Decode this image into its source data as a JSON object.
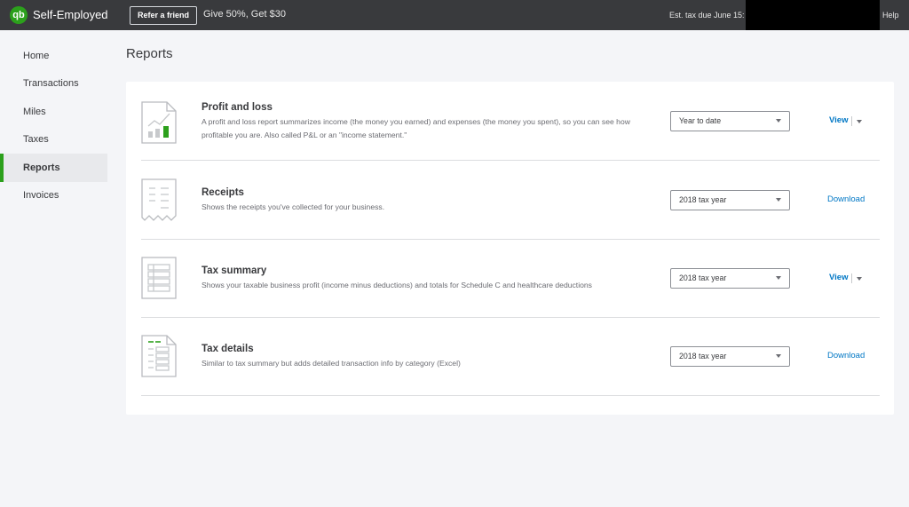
{
  "topbar": {
    "logo_text": "qb",
    "brand": "Self-Employed",
    "refer_button": "Refer a friend",
    "promo": "Give 50%, Get $30",
    "tax_due_label": "Est. tax due June 15:",
    "help": "Help"
  },
  "sidebar": {
    "items": [
      {
        "label": "Home"
      },
      {
        "label": "Transactions"
      },
      {
        "label": "Miles"
      },
      {
        "label": "Taxes"
      },
      {
        "label": "Reports",
        "active": true
      },
      {
        "label": "Invoices"
      }
    ]
  },
  "page": {
    "title": "Reports"
  },
  "reports": [
    {
      "title": "Profit and loss",
      "description": "A profit and loss report summarizes income (the money you earned) and expenses (the money you spent), so you can see how profitable you are. Also called P&L or an \"income statement.\"",
      "selected_period": "Year to date",
      "action": "View",
      "icon": "profit-loss-chart-icon"
    },
    {
      "title": "Receipts",
      "description": "Shows the receipts you've collected for your business.",
      "selected_period": "2018 tax year",
      "action": "Download",
      "icon": "receipt-icon"
    },
    {
      "title": "Tax summary",
      "description": "Shows your taxable business profit (income minus deductions) and totals for Schedule C and healthcare deductions",
      "selected_period": "2018 tax year",
      "action": "View",
      "icon": "tax-summary-icon"
    },
    {
      "title": "Tax details",
      "description": "Similar to tax summary but adds detailed transaction info by category (Excel)",
      "selected_period": "2018 tax year",
      "action": "Download",
      "icon": "tax-details-icon"
    }
  ],
  "colors": {
    "brand_green": "#2ca01c",
    "topbar": "#393a3d",
    "link_blue": "#0077c5"
  }
}
